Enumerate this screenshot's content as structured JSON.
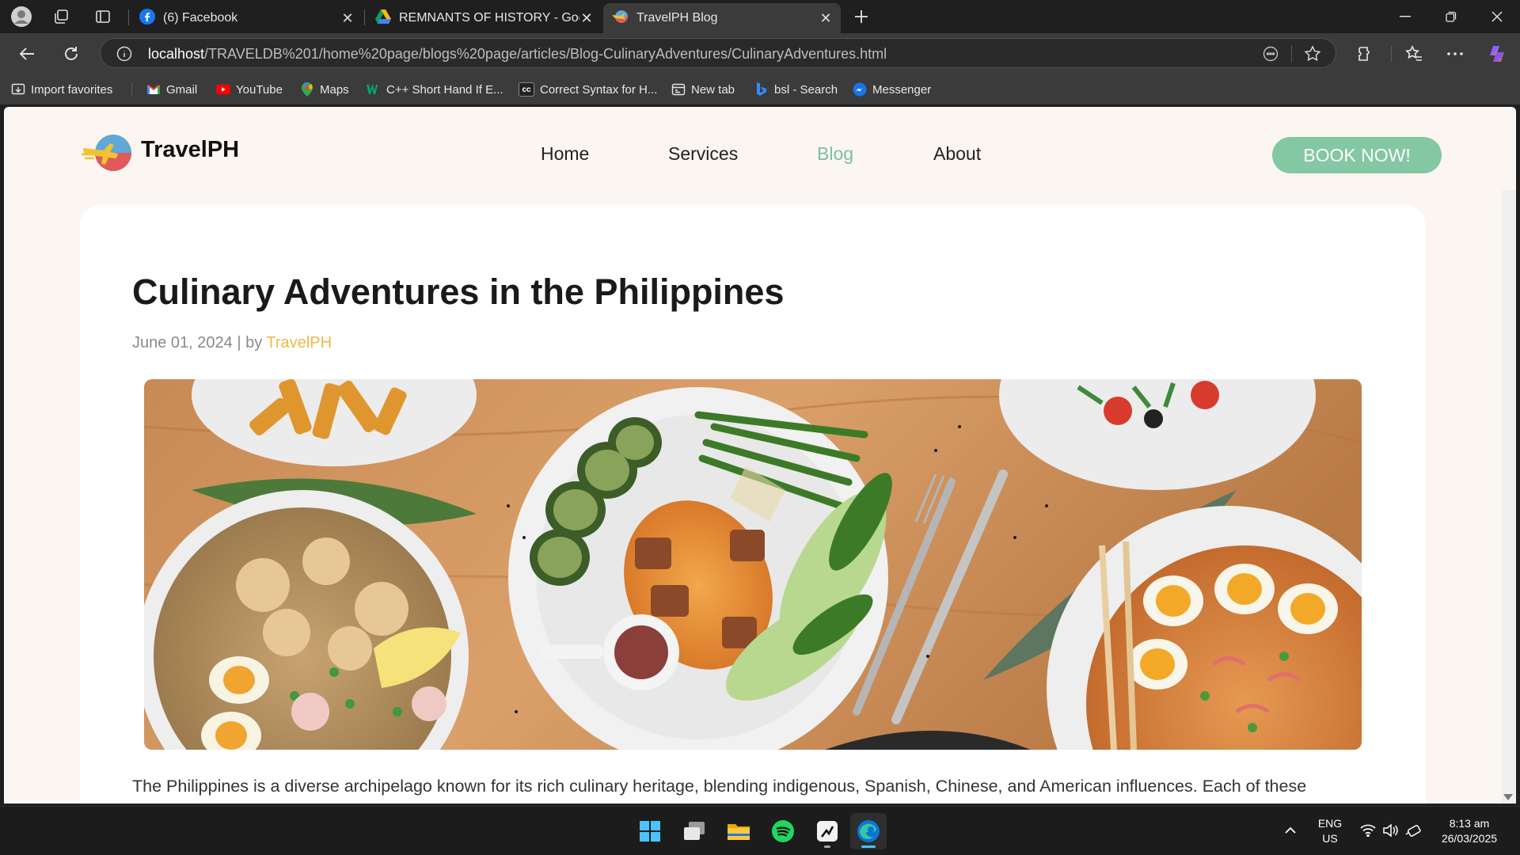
{
  "browser": {
    "tabs": [
      {
        "title": "(6) Facebook",
        "icon": "facebook-icon",
        "active": false
      },
      {
        "title": "REMNANTS OF HISTORY - Google",
        "icon": "google-drive-icon",
        "active": false
      },
      {
        "title": "TravelPH Blog",
        "icon": "travelph-icon",
        "active": true
      }
    ],
    "address": {
      "host": "localhost",
      "path": "/TRAVELDB%201/home%20page/blogs%20page/articles/Blog-CulinaryAdventures/CulinaryAdventures.html"
    },
    "bookmarks": [
      {
        "label": "Import favorites",
        "icon": "import-icon"
      },
      {
        "label": "Gmail",
        "icon": "gmail-icon"
      },
      {
        "label": "YouTube",
        "icon": "youtube-icon"
      },
      {
        "label": "Maps",
        "icon": "maps-icon"
      },
      {
        "label": "C++ Short Hand If E...",
        "icon": "w3schools-icon"
      },
      {
        "label": "Correct Syntax for H...",
        "icon": "cc-icon"
      },
      {
        "label": "New tab",
        "icon": "new-tab-icon"
      },
      {
        "label": "bsl - Search",
        "icon": "bing-icon"
      },
      {
        "label": "Messenger",
        "icon": "messenger-icon"
      }
    ]
  },
  "site": {
    "brand": "TravelPH",
    "nav": [
      "Home",
      "Services",
      "Blog",
      "About"
    ],
    "active_nav": "Blog",
    "cta": "BOOK NOW!",
    "colors": {
      "accent": "#84c7a3",
      "author": "#f0b84a",
      "background": "#fbf6f1"
    }
  },
  "article": {
    "title": "Culinary Adventures in the Philippines",
    "date": "June 01, 2024",
    "separator": "| by",
    "author": "TravelPH",
    "intro": "The Philippines is a diverse archipelago known for its rich culinary heritage, blending indigenous, Spanish, Chinese, and American influences. Each of these"
  },
  "taskbar": {
    "apps": [
      "windows-start-icon",
      "task-view-icon",
      "file-explorer-icon",
      "spotify-icon",
      "app-icon",
      "edge-icon"
    ],
    "language": "ENG",
    "region": "US",
    "time": "8:13 am",
    "date": "26/03/2025"
  }
}
